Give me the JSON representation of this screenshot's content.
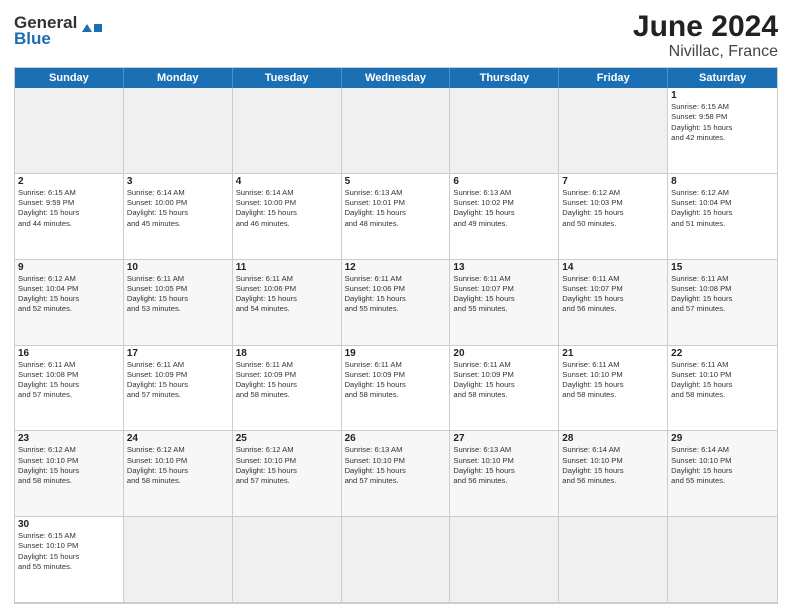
{
  "header": {
    "logo_text_black": "General",
    "logo_text_blue": "Blue",
    "month": "June 2024",
    "location": "Nivillac, France"
  },
  "weekdays": [
    "Sunday",
    "Monday",
    "Tuesday",
    "Wednesday",
    "Thursday",
    "Friday",
    "Saturday"
  ],
  "cells": [
    {
      "day": "",
      "text": "",
      "empty": true
    },
    {
      "day": "",
      "text": "",
      "empty": true
    },
    {
      "day": "",
      "text": "",
      "empty": true
    },
    {
      "day": "",
      "text": "",
      "empty": true
    },
    {
      "day": "",
      "text": "",
      "empty": true
    },
    {
      "day": "",
      "text": "",
      "empty": true
    },
    {
      "day": "1",
      "text": "Sunrise: 6:15 AM\nSunset: 9:58 PM\nDaylight: 15 hours\nand 42 minutes.",
      "empty": false
    },
    {
      "day": "2",
      "text": "Sunrise: 6:15 AM\nSunset: 9:59 PM\nDaylight: 15 hours\nand 44 minutes.",
      "empty": false
    },
    {
      "day": "3",
      "text": "Sunrise: 6:14 AM\nSunset: 10:00 PM\nDaylight: 15 hours\nand 45 minutes.",
      "empty": false
    },
    {
      "day": "4",
      "text": "Sunrise: 6:14 AM\nSunset: 10:00 PM\nDaylight: 15 hours\nand 46 minutes.",
      "empty": false
    },
    {
      "day": "5",
      "text": "Sunrise: 6:13 AM\nSunset: 10:01 PM\nDaylight: 15 hours\nand 48 minutes.",
      "empty": false
    },
    {
      "day": "6",
      "text": "Sunrise: 6:13 AM\nSunset: 10:02 PM\nDaylight: 15 hours\nand 49 minutes.",
      "empty": false
    },
    {
      "day": "7",
      "text": "Sunrise: 6:12 AM\nSunset: 10:03 PM\nDaylight: 15 hours\nand 50 minutes.",
      "empty": false
    },
    {
      "day": "8",
      "text": "Sunrise: 6:12 AM\nSunset: 10:04 PM\nDaylight: 15 hours\nand 51 minutes.",
      "empty": false
    },
    {
      "day": "9",
      "text": "Sunrise: 6:12 AM\nSunset: 10:04 PM\nDaylight: 15 hours\nand 52 minutes.",
      "empty": false
    },
    {
      "day": "10",
      "text": "Sunrise: 6:11 AM\nSunset: 10:05 PM\nDaylight: 15 hours\nand 53 minutes.",
      "empty": false
    },
    {
      "day": "11",
      "text": "Sunrise: 6:11 AM\nSunset: 10:06 PM\nDaylight: 15 hours\nand 54 minutes.",
      "empty": false
    },
    {
      "day": "12",
      "text": "Sunrise: 6:11 AM\nSunset: 10:06 PM\nDaylight: 15 hours\nand 55 minutes.",
      "empty": false
    },
    {
      "day": "13",
      "text": "Sunrise: 6:11 AM\nSunset: 10:07 PM\nDaylight: 15 hours\nand 55 minutes.",
      "empty": false
    },
    {
      "day": "14",
      "text": "Sunrise: 6:11 AM\nSunset: 10:07 PM\nDaylight: 15 hours\nand 56 minutes.",
      "empty": false
    },
    {
      "day": "15",
      "text": "Sunrise: 6:11 AM\nSunset: 10:08 PM\nDaylight: 15 hours\nand 57 minutes.",
      "empty": false
    },
    {
      "day": "16",
      "text": "Sunrise: 6:11 AM\nSunset: 10:08 PM\nDaylight: 15 hours\nand 57 minutes.",
      "empty": false
    },
    {
      "day": "17",
      "text": "Sunrise: 6:11 AM\nSunset: 10:09 PM\nDaylight: 15 hours\nand 57 minutes.",
      "empty": false
    },
    {
      "day": "18",
      "text": "Sunrise: 6:11 AM\nSunset: 10:09 PM\nDaylight: 15 hours\nand 58 minutes.",
      "empty": false
    },
    {
      "day": "19",
      "text": "Sunrise: 6:11 AM\nSunset: 10:09 PM\nDaylight: 15 hours\nand 58 minutes.",
      "empty": false
    },
    {
      "day": "20",
      "text": "Sunrise: 6:11 AM\nSunset: 10:09 PM\nDaylight: 15 hours\nand 58 minutes.",
      "empty": false
    },
    {
      "day": "21",
      "text": "Sunrise: 6:11 AM\nSunset: 10:10 PM\nDaylight: 15 hours\nand 58 minutes.",
      "empty": false
    },
    {
      "day": "22",
      "text": "Sunrise: 6:11 AM\nSunset: 10:10 PM\nDaylight: 15 hours\nand 58 minutes.",
      "empty": false
    },
    {
      "day": "23",
      "text": "Sunrise: 6:12 AM\nSunset: 10:10 PM\nDaylight: 15 hours\nand 58 minutes.",
      "empty": false
    },
    {
      "day": "24",
      "text": "Sunrise: 6:12 AM\nSunset: 10:10 PM\nDaylight: 15 hours\nand 58 minutes.",
      "empty": false
    },
    {
      "day": "25",
      "text": "Sunrise: 6:12 AM\nSunset: 10:10 PM\nDaylight: 15 hours\nand 57 minutes.",
      "empty": false
    },
    {
      "day": "26",
      "text": "Sunrise: 6:13 AM\nSunset: 10:10 PM\nDaylight: 15 hours\nand 57 minutes.",
      "empty": false
    },
    {
      "day": "27",
      "text": "Sunrise: 6:13 AM\nSunset: 10:10 PM\nDaylight: 15 hours\nand 56 minutes.",
      "empty": false
    },
    {
      "day": "28",
      "text": "Sunrise: 6:14 AM\nSunset: 10:10 PM\nDaylight: 15 hours\nand 56 minutes.",
      "empty": false
    },
    {
      "day": "29",
      "text": "Sunrise: 6:14 AM\nSunset: 10:10 PM\nDaylight: 15 hours\nand 55 minutes.",
      "empty": false
    },
    {
      "day": "30",
      "text": "Sunrise: 6:15 AM\nSunset: 10:10 PM\nDaylight: 15 hours\nand 55 minutes.",
      "empty": false
    },
    {
      "day": "",
      "text": "",
      "empty": true
    },
    {
      "day": "",
      "text": "",
      "empty": true
    },
    {
      "day": "",
      "text": "",
      "empty": true
    },
    {
      "day": "",
      "text": "",
      "empty": true
    },
    {
      "day": "",
      "text": "",
      "empty": true
    },
    {
      "day": "",
      "text": "",
      "empty": true
    }
  ]
}
